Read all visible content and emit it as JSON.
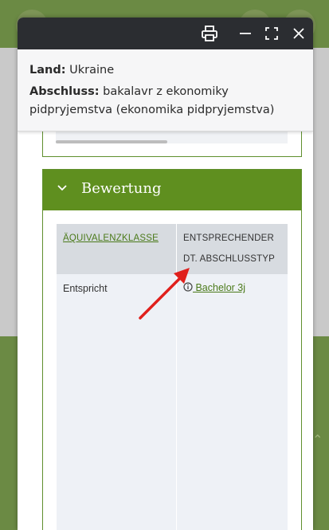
{
  "info": {
    "land_label": "Land:",
    "land_value": "Ukraine",
    "abschluss_label": "Abschluss:",
    "abschluss_line1": "bakalavr z ekonomiky",
    "abschluss_line2": "pidpryjemstva (ekonomika pidpryjemstva)"
  },
  "section": {
    "title": "Bewertung"
  },
  "table": {
    "headers": {
      "col1": "ÄQUIVALENZKLASSE",
      "col2_line1": "ENTSPRECHENDER",
      "col2_line2": "DT. ABSCHLUSSTYP"
    },
    "rows": [
      {
        "klasse": "Entspricht",
        "typ": " Bachelor 3j"
      }
    ]
  },
  "colors": {
    "accent": "#5f8f1f",
    "titlebar": "#2b2d31",
    "link": "#4b7a1a",
    "arrow": "#e0201c"
  },
  "icons": [
    "print-icon",
    "minimize-icon",
    "maximize-icon",
    "close-icon",
    "chevron-down-icon",
    "info-icon"
  ]
}
